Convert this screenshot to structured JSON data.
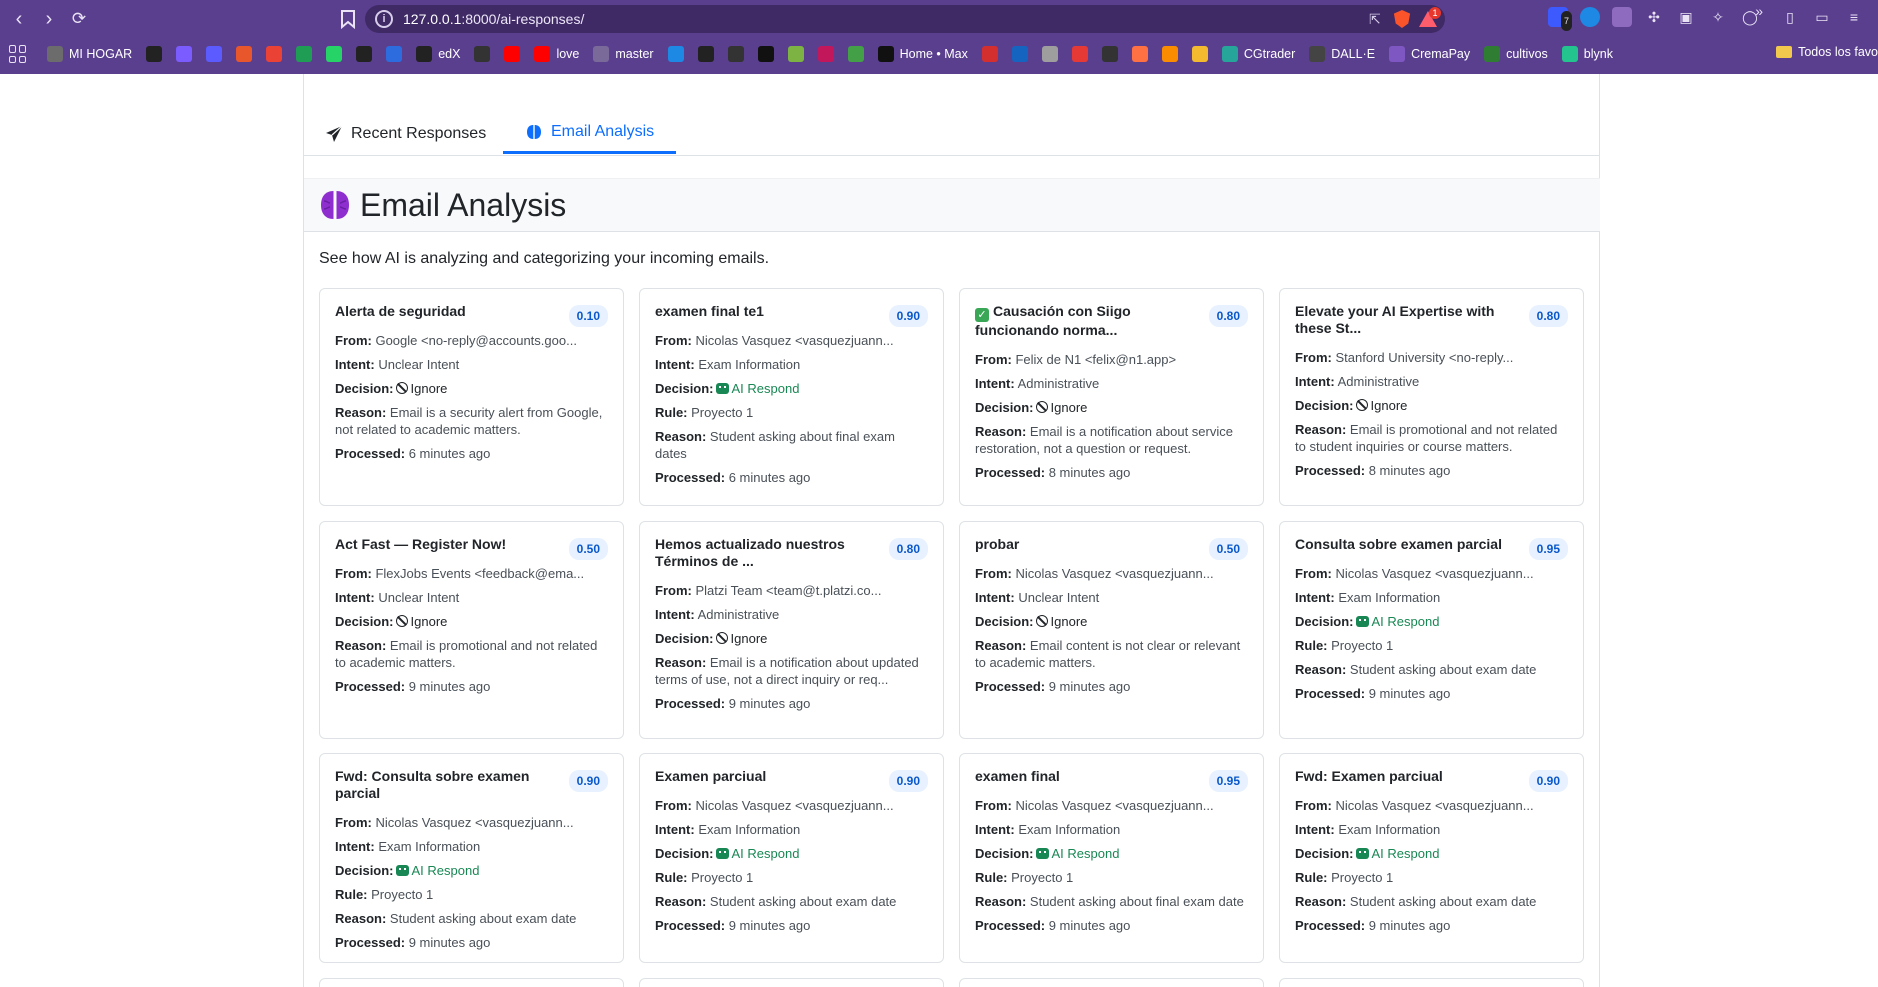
{
  "browser": {
    "url_host": "127.0.0.1",
    "url_path": ":8000/ai-responses/",
    "rewards_badge": "1",
    "ext_badge": "7",
    "bookmarks": [
      {
        "label": "MI HOGAR",
        "icon": "d-icon",
        "color": "#6c6c6c"
      },
      {
        "label": "",
        "icon": "a-icon",
        "color": "#222222"
      },
      {
        "label": "",
        "icon": "meta-icon",
        "color": "#7b5cff"
      },
      {
        "label": "",
        "icon": "p-icon",
        "color": "#5b5bff"
      },
      {
        "label": "",
        "icon": "spark-icon",
        "color": "#e8572c"
      },
      {
        "label": "",
        "icon": "gmail-icon",
        "color": "#ea4335"
      },
      {
        "label": "",
        "icon": "w-icon",
        "color": "#1f9d55"
      },
      {
        "label": "",
        "icon": "whatsapp-icon",
        "color": "#25d366"
      },
      {
        "label": "",
        "icon": "github-icon",
        "color": "#222222"
      },
      {
        "label": "",
        "icon": "c-icon",
        "color": "#2d6cdf"
      },
      {
        "label": "edX",
        "icon": "x-icon",
        "color": "#222222"
      },
      {
        "label": "",
        "icon": "cc-icon",
        "color": "#333333"
      },
      {
        "label": "",
        "icon": "youtube-icon",
        "color": "#ff0000"
      },
      {
        "label": "love",
        "icon": "youtube-icon",
        "color": "#ff0000"
      },
      {
        "label": "master",
        "icon": "gear-icon",
        "color": "#7a6a9a"
      },
      {
        "label": "",
        "icon": "play-icon",
        "color": "#1e88e5"
      },
      {
        "label": "",
        "icon": "b-icon",
        "color": "#222222"
      },
      {
        "label": "",
        "icon": "af-icon",
        "color": "#333333"
      },
      {
        "label": "",
        "icon": "x-icon",
        "color": "#111111"
      },
      {
        "label": "",
        "icon": "7-icon",
        "color": "#7cb342"
      },
      {
        "label": "",
        "icon": "s-icon",
        "color": "#c2185b"
      },
      {
        "label": "",
        "icon": "bulb-icon",
        "color": "#43a047"
      },
      {
        "label": "Home • Max",
        "icon": "max-icon",
        "color": "#111111"
      },
      {
        "label": "",
        "icon": "bar-icon",
        "color": "#d32f2f"
      },
      {
        "label": "",
        "icon": "bird-icon",
        "color": "#1565c0"
      },
      {
        "label": "",
        "icon": "doc-icon",
        "color": "#9e9e9e"
      },
      {
        "label": "",
        "icon": "down-icon",
        "color": "#e53935"
      },
      {
        "label": "",
        "icon": "c2-icon",
        "color": "#333333"
      },
      {
        "label": "",
        "icon": "fire-icon",
        "color": "#ff7043"
      },
      {
        "label": "",
        "icon": "box-icon",
        "color": "#fb8c00"
      },
      {
        "label": "",
        "icon": "binance-icon",
        "color": "#f3ba2f"
      },
      {
        "label": "CGtrader",
        "icon": "cg-icon",
        "color": "#26a69a"
      },
      {
        "label": "DALL·E",
        "icon": "dalle-icon",
        "color": "#444444"
      },
      {
        "label": "CremaPay",
        "icon": "crema-icon",
        "color": "#7e57c2"
      },
      {
        "label": "cultivos",
        "icon": "leaf-icon",
        "color": "#2e7d32"
      },
      {
        "label": "blynk",
        "icon": "blynk-icon",
        "color": "#23c48e"
      }
    ],
    "folder_label": "Todos los favo"
  },
  "tabs": {
    "recent": "Recent Responses",
    "analysis": "Email Analysis"
  },
  "header": {
    "title": "Email Analysis",
    "subtitle": "See how AI is analyzing and categorizing your incoming emails."
  },
  "labels": {
    "from": "From:",
    "intent": "Intent:",
    "decision": "Decision:",
    "rule": "Rule:",
    "reason": "Reason:",
    "processed": "Processed:"
  },
  "emails": [
    {
      "title": "Alerta de seguridad",
      "score": "0.10",
      "from": "Google <no-reply@accounts.goo...",
      "intent": "Unclear Intent",
      "decision": "Ignore",
      "rule": "",
      "reason": "Email is a security alert from Google, not related to academic matters.",
      "processed": "6 minutes ago"
    },
    {
      "title": "examen final te1",
      "score": "0.90",
      "from": "Nicolas Vasquez <vasquezjuann...",
      "intent": "Exam Information",
      "decision": "AI Respond",
      "rule": "Proyecto 1",
      "reason": "Student asking about final exam dates",
      "processed": "6 minutes ago"
    },
    {
      "title": "Causación con Siigo funcionando norma...",
      "score": "0.80",
      "from": "Felix de N1 <felix@n1.app>",
      "intent": "Administrative",
      "decision": "Ignore",
      "rule": "",
      "reason": "Email is a notification about service restoration, not a question or request.",
      "processed": "8 minutes ago",
      "check": true
    },
    {
      "title": "Elevate your AI Expertise with these St...",
      "score": "0.80",
      "from": "Stanford University <no-reply...",
      "intent": "Administrative",
      "decision": "Ignore",
      "rule": "",
      "reason": "Email is promotional and not related to student inquiries or course matters.",
      "processed": "8 minutes ago"
    },
    {
      "title": "Act Fast — Register Now!",
      "score": "0.50",
      "from": "FlexJobs Events <feedback@ema...",
      "intent": "Unclear Intent",
      "decision": "Ignore",
      "rule": "",
      "reason": "Email is promotional and not related to academic matters.",
      "processed": "9 minutes ago"
    },
    {
      "title": "Hemos actualizado nuestros Términos de ...",
      "score": "0.80",
      "from": "Platzi Team <team@t.platzi.co...",
      "intent": "Administrative",
      "decision": "Ignore",
      "rule": "",
      "reason": "Email is a notification about updated terms of use, not a direct inquiry or req...",
      "processed": "9 minutes ago"
    },
    {
      "title": "probar",
      "score": "0.50",
      "from": "Nicolas Vasquez <vasquezjuann...",
      "intent": "Unclear Intent",
      "decision": "Ignore",
      "rule": "",
      "reason": "Email content is not clear or relevant to academic matters.",
      "processed": "9 minutes ago"
    },
    {
      "title": "Consulta sobre examen parcial",
      "score": "0.95",
      "from": "Nicolas Vasquez <vasquezjuann...",
      "intent": "Exam Information",
      "decision": "AI Respond",
      "rule": "Proyecto 1",
      "reason": "Student asking about exam date",
      "processed": "9 minutes ago"
    },
    {
      "title": "Fwd: Consulta sobre examen parcial",
      "score": "0.90",
      "from": "Nicolas Vasquez <vasquezjuann...",
      "intent": "Exam Information",
      "decision": "AI Respond",
      "rule": "Proyecto 1",
      "reason": "Student asking about exam date",
      "processed": "9 minutes ago"
    },
    {
      "title": "Examen parciual",
      "score": "0.90",
      "from": "Nicolas Vasquez <vasquezjuann...",
      "intent": "Exam Information",
      "decision": "AI Respond",
      "rule": "Proyecto 1",
      "reason": "Student asking about exam date",
      "processed": "9 minutes ago"
    },
    {
      "title": "examen final",
      "score": "0.95",
      "from": "Nicolas Vasquez <vasquezjuann...",
      "intent": "Exam Information",
      "decision": "AI Respond",
      "rule": "Proyecto 1",
      "reason": "Student asking about final exam date",
      "processed": "9 minutes ago"
    },
    {
      "title": "Fwd: Examen parciual",
      "score": "0.90",
      "from": "Nicolas Vasquez <vasquezjuann...",
      "intent": "Exam Information",
      "decision": "AI Respond",
      "rule": "Proyecto 1",
      "reason": "Student asking about exam date",
      "processed": "9 minutes ago"
    }
  ]
}
